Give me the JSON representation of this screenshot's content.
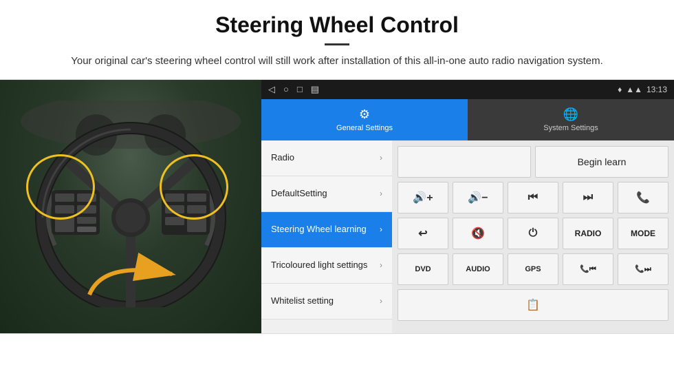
{
  "header": {
    "title": "Steering Wheel Control",
    "subtitle": "Your original car's steering wheel control will still work after installation of this all-in-one auto radio navigation system."
  },
  "status_bar": {
    "nav_back": "◁",
    "nav_home": "○",
    "nav_recent": "□",
    "nav_extra": "▤",
    "time": "13:13",
    "location_icon": "♦",
    "signal_icon": "▲"
  },
  "tabs": [
    {
      "label": "General Settings",
      "icon": "⚙",
      "active": true
    },
    {
      "label": "System Settings",
      "icon": "🌐",
      "active": false
    }
  ],
  "menu": {
    "items": [
      {
        "label": "Radio",
        "active": false
      },
      {
        "label": "DefaultSetting",
        "active": false
      },
      {
        "label": "Steering Wheel learning",
        "active": true
      },
      {
        "label": "Tricoloured light settings",
        "active": false
      },
      {
        "label": "Whitelist setting",
        "active": false
      }
    ]
  },
  "right_panel": {
    "begin_learn_label": "Begin learn",
    "controls_row1": [
      "🔊+",
      "🔊−",
      "⏮",
      "⏭",
      "📞"
    ],
    "controls_row2": [
      "↩",
      "🔇",
      "⏻",
      "RADIO",
      "MODE"
    ],
    "media_buttons": [
      "DVD",
      "AUDIO",
      "GPS",
      "📞⏮",
      "📞⏭"
    ],
    "extra_icon": "📋"
  }
}
